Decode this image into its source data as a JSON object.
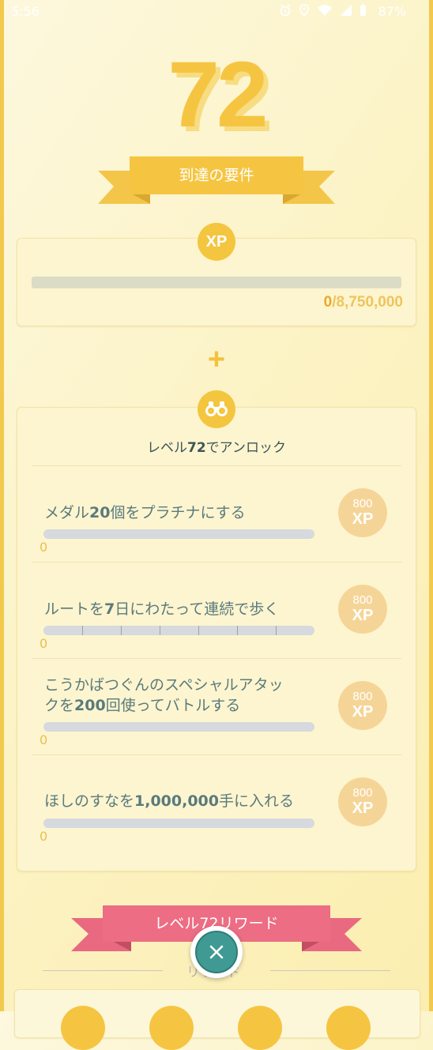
{
  "status_bar": {
    "time": "5:56",
    "battery": "87%",
    "icons": [
      "alarm-icon",
      "location-icon",
      "wifi-icon",
      "signal-icon",
      "battery-icon"
    ]
  },
  "level": "72",
  "requirements_banner": "到達の要件",
  "xp_section": {
    "badge": "XP",
    "current": "0",
    "target": "/8,750,000",
    "progress": 0
  },
  "plus": "+",
  "unlock_section": {
    "title_prefix": "レベル",
    "title_level": "72",
    "title_suffix": "でアンロック",
    "tasks": [
      {
        "pre": "メダル",
        "num": "20",
        "post": "個をプラチナにする",
        "progress": "0",
        "reward_amount": "800",
        "reward_unit": "XP",
        "segments": 0
      },
      {
        "pre": "ルートを",
        "num": "7",
        "post": "日にわたって連続で歩く",
        "progress": "0",
        "reward_amount": "800",
        "reward_unit": "XP",
        "segments": 7
      },
      {
        "line1": "こうかばつぐんのスペシャルアタッ",
        "line2_pre": "クを",
        "line2_num": "200",
        "line2_post": "回使ってバトルする",
        "progress": "0",
        "reward_amount": "800",
        "reward_unit": "XP",
        "segments": 0
      },
      {
        "pre": "ほしのすなを",
        "num": "1,000,000",
        "post": "手に入れる",
        "progress": "0",
        "reward_amount": "800",
        "reward_unit": "XP",
        "segments": 0
      }
    ]
  },
  "rewards_banner": "レベル72リワード",
  "rewards_label": "リワード",
  "colors": {
    "gold": "#f4c53e",
    "pink": "#ec6b82",
    "teal": "#3f9a94"
  }
}
